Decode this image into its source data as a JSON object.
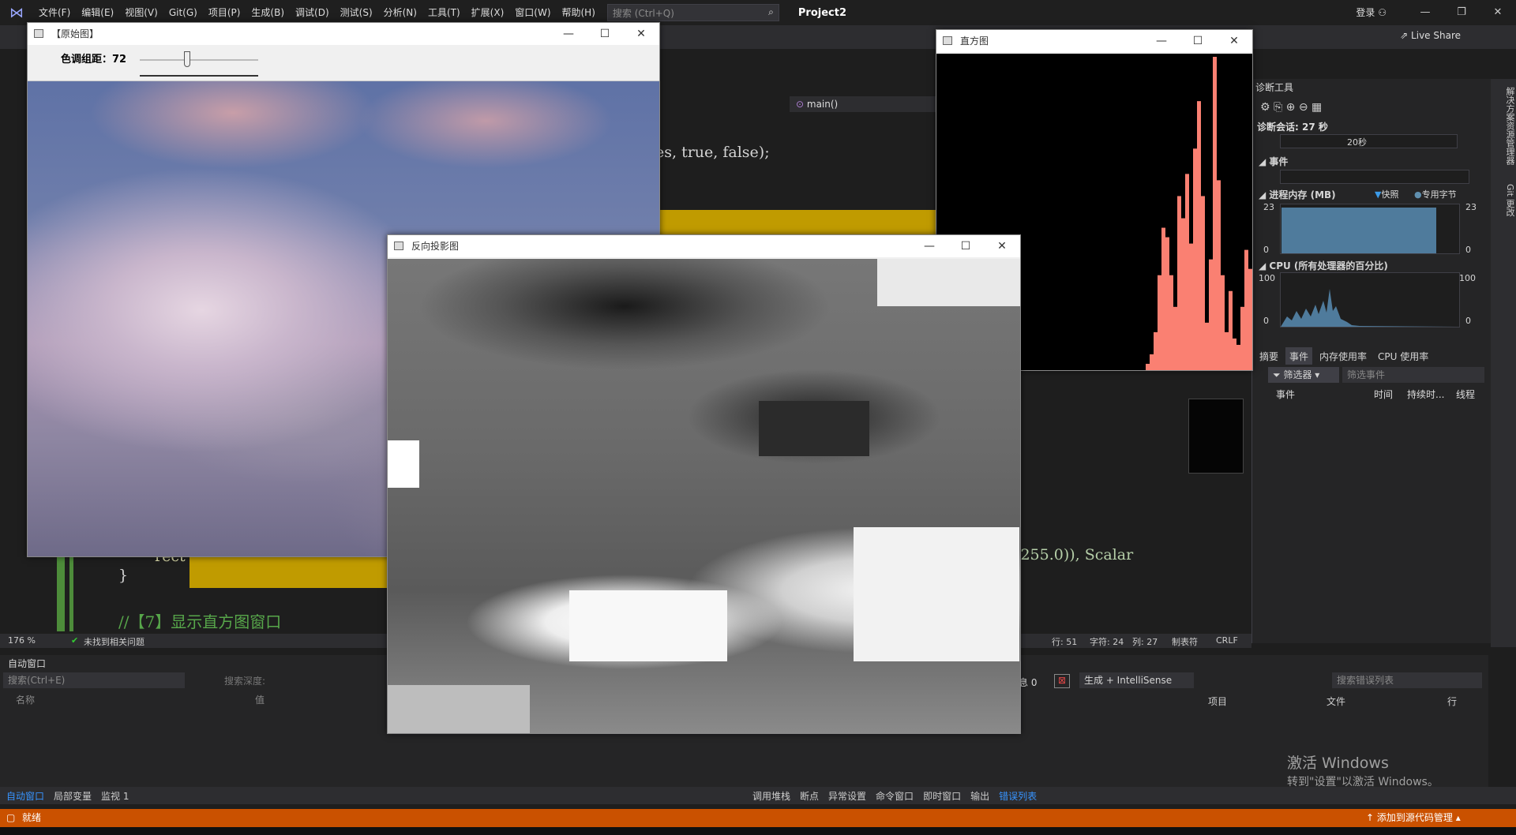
{
  "vs": {
    "menu": [
      "文件(F)",
      "编辑(E)",
      "视图(V)",
      "Git(G)",
      "项目(P)",
      "生成(B)",
      "调试(D)",
      "测试(S)",
      "分析(N)",
      "工具(T)",
      "扩展(X)",
      "窗口(W)",
      "帮助(H)"
    ],
    "search_placeholder": "搜索 (Ctrl+Q)",
    "project": "Project2",
    "login": "登录",
    "live_share": "Live Share",
    "nav_member": "main()",
    "code_line_1": "es,  true,  false);",
    "code_line_2": "/ 255.0)),  Scalar",
    "code_line_3": "rect",
    "code_line_4": "}",
    "code_comment": "//【7】显示直方图窗口",
    "zoom": "176 %",
    "issues": "未找到相关问题",
    "cursor": {
      "line": "行: 51",
      "char": "字符: 24",
      "col": "列: 27",
      "tabs": "制表符",
      "eol": "CRLF"
    }
  },
  "diag": {
    "title": "诊断工具",
    "session": "诊断会话: 27 秒",
    "timeline_label": "20秒",
    "events_section": "事件",
    "memory_section": "进程内存 (MB)",
    "legend_snapshot": "快照",
    "legend_private": "专用字节",
    "mem_max": "23",
    "mem_min": "0",
    "cpu_section": "CPU (所有处理器的百分比)",
    "cpu_max": "100",
    "cpu_min": "0",
    "tabs": [
      "摘要",
      "事件",
      "内存使用率",
      "CPU 使用率"
    ],
    "filter_label": "筛选器",
    "filter_placeholder": "筛选事件",
    "columns": [
      "事件",
      "时间",
      "持续时...",
      "线程"
    ]
  },
  "side_tabs": [
    "解决方案资源管理器",
    "Git 更改"
  ],
  "autos": {
    "title": "自动窗口",
    "search_placeholder": "搜索(Ctrl+E)",
    "depth_label": "搜索深度:",
    "col_name": "名称",
    "col_value": "值"
  },
  "errors": {
    "msgs_label": "息 0",
    "build_filter": "生成 + IntelliSense",
    "search_placeholder": "搜索错误列表",
    "col_project": "项目",
    "col_file": "文件",
    "col_line": "行"
  },
  "bottom_tabs_left": [
    "自动窗口",
    "局部变量",
    "监视 1"
  ],
  "bottom_tabs_right": [
    "调用堆栈",
    "断点",
    "异常设置",
    "命令窗口",
    "即时窗口",
    "输出",
    "错误列表"
  ],
  "status": {
    "ready": "就绪",
    "source_control": "添加到源代码管理"
  },
  "watermark": {
    "line1": "激活 Windows",
    "line2": "转到\"设置\"以激活 Windows。"
  },
  "windows": {
    "original": {
      "title": "【原始图】",
      "trackbar_label": "色调组距：72",
      "trackbar_fraction": 0.4
    },
    "histogram": {
      "title": "直方图"
    },
    "backproject": {
      "title": "反向投影图"
    }
  },
  "histogram_bars": {
    "color": "#fa8072",
    "values": [
      0.02,
      0.05,
      0.12,
      0.3,
      0.45,
      0.42,
      0.3,
      0.2,
      0.55,
      0.48,
      0.62,
      0.4,
      0.7,
      0.85,
      0.55,
      0.15,
      0.35,
      0.99,
      0.6,
      0.3,
      0.12,
      0.25,
      0.1,
      0.08,
      0.2,
      0.38,
      0.32,
      0.18
    ]
  },
  "diag_colors": {
    "mem": "#4f7b9c",
    "cpu": "#4f7b9c"
  }
}
